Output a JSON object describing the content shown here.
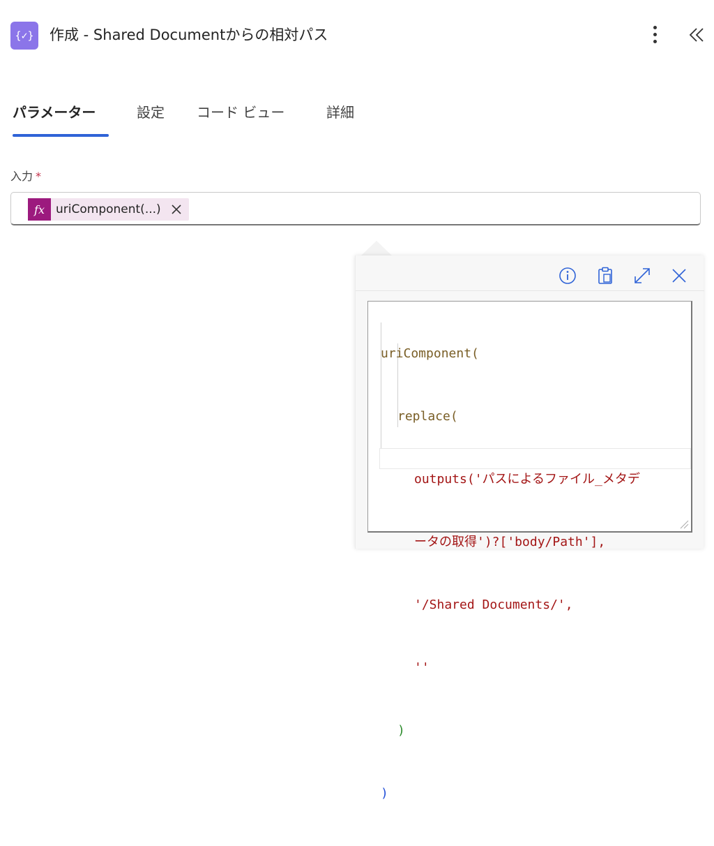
{
  "header": {
    "icon_glyph": "{✓}",
    "title": "作成 - Shared Documentからの相対パス",
    "more_icon": "more-vertical-icon",
    "collapse_icon": "chevron-double-left-icon"
  },
  "tabs": [
    {
      "label": "パラメーター",
      "active": true
    },
    {
      "label": "設定",
      "active": false
    },
    {
      "label": "コード ビュー",
      "active": false
    },
    {
      "label": "詳細",
      "active": false
    }
  ],
  "field": {
    "label": "入力",
    "required_mark": "*",
    "token": {
      "icon_label": "fx",
      "text": "uriComponent(...)"
    }
  },
  "popover": {
    "toolbar": [
      "info-icon",
      "clipboard-icon",
      "expand-icon",
      "close-icon"
    ],
    "code_lines": [
      "uriComponent(",
      "replace(",
      "outputs('パスによるファイル_メタデ",
      "ータの取得')?['body/Path'],",
      "'/Shared Documents/',",
      "''",
      ")",
      ")"
    ]
  },
  "colors": {
    "accent": "#2f63d7",
    "app_icon": "#8b75e9",
    "fx_badge": "#9c1a7e",
    "token_bg": "#f3e5f0",
    "required": "#c4314b"
  }
}
